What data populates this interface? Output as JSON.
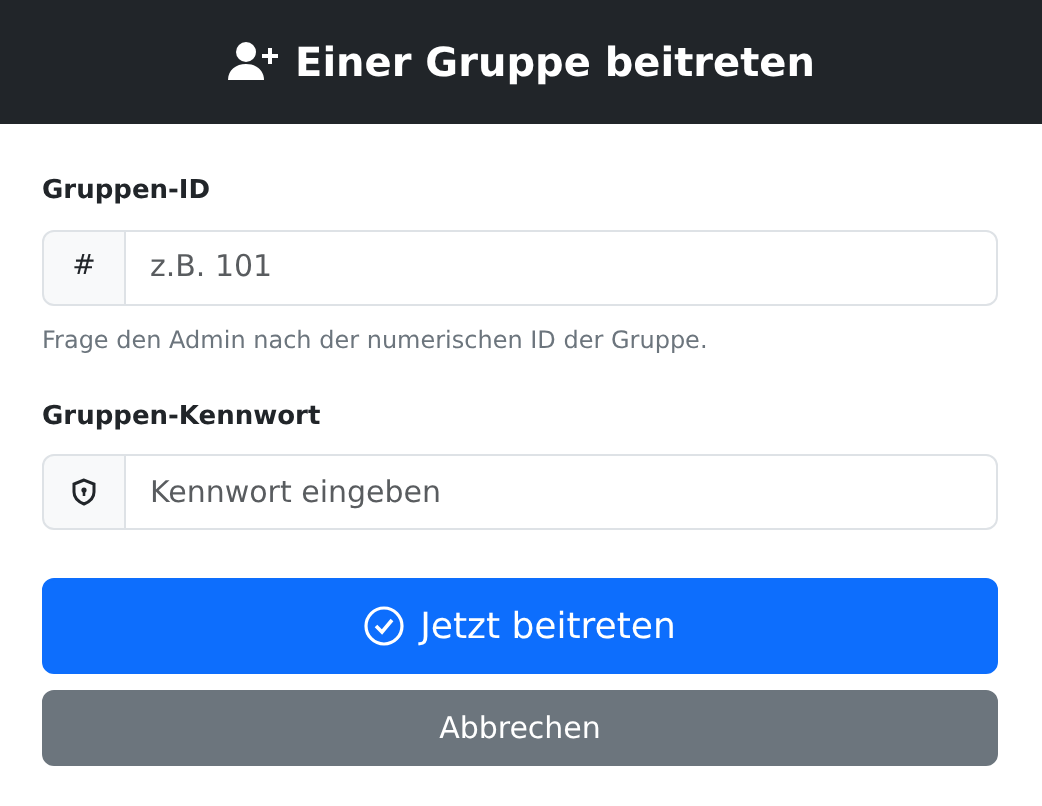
{
  "header": {
    "title": "Einer Gruppe beitreten"
  },
  "fields": [
    {
      "label": "Gruppen-ID",
      "kind": "text",
      "addon": "#",
      "placeholder": "z.B. 101",
      "hint": "Frage den Admin nach der numerischen ID der Gruppe."
    },
    {
      "label": "Gruppen-Kennwort",
      "kind": "shield",
      "placeholder": "Kennwort eingeben"
    }
  ],
  "buttons": [
    {
      "label": "Jetzt beitreten",
      "kind": "primary"
    },
    {
      "label": "Abbrechen",
      "kind": "secondary"
    }
  ]
}
